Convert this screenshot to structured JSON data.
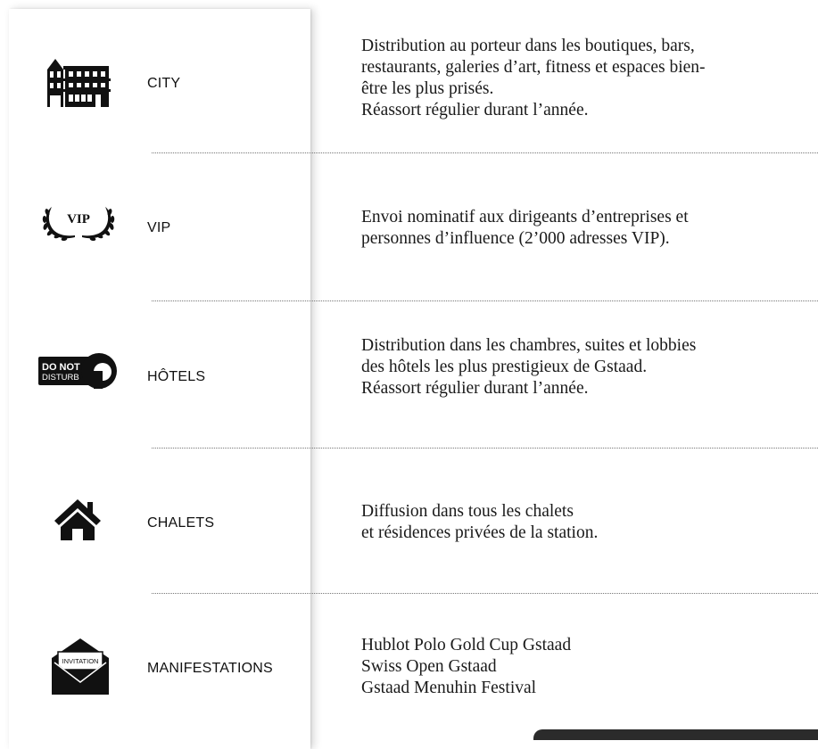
{
  "rows": [
    {
      "icon": "building-icon",
      "label": "CITY",
      "lines": [
        "Distribution au porteur dans les boutiques, bars,",
        "restaurants, galeries d’art, fitness et espaces bien-",
        "être les plus prisés.",
        "Réassort régulier durant l’année."
      ]
    },
    {
      "icon": "laurel-vip-icon",
      "icon_text": "VIP",
      "label": "VIP",
      "lines": [
        "Envoi nominatif aux dirigeants d’entreprises et",
        "personnes d’influence (2’000 adresses VIP)."
      ]
    },
    {
      "icon": "do-not-disturb-icon",
      "icon_text": [
        "DO NOT",
        "DISTURB"
      ],
      "label": "HÔTELS",
      "lines": [
        "Distribution dans les chambres, suites et lobbies",
        "des hôtels les plus prestigieux de Gstaad.",
        "Réassort régulier durant l’année."
      ]
    },
    {
      "icon": "house-icon",
      "label": "CHALETS",
      "lines": [
        "Diffusion dans tous les chalets",
        "et résidences privées de la station."
      ]
    },
    {
      "icon": "invitation-envelope-icon",
      "icon_text": "INVITATION",
      "label": "MANIFESTATIONS",
      "lines": [
        "Hublot Polo Gold Cup Gstaad",
        "Swiss Open Gstaad",
        "Gstaad Menuhin Festival"
      ]
    }
  ],
  "colors": {
    "text": "#1a1a1a",
    "icon": "#111111",
    "divider": "#777777",
    "panel_shadow": "#d8d8d8",
    "bottom_tab": "#2b2b2b"
  }
}
